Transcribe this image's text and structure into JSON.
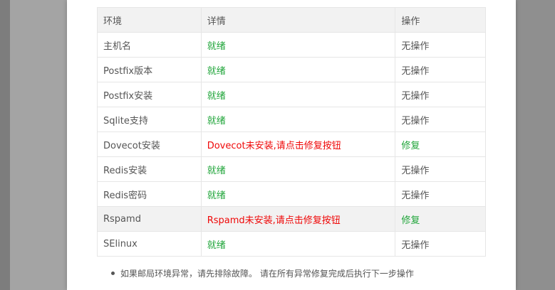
{
  "table": {
    "headers": [
      "环境",
      "详情",
      "操作"
    ],
    "rows": [
      {
        "name": "主机名",
        "detail": "就绪",
        "detail_status": "ok",
        "action": "无操作",
        "action_type": "none"
      },
      {
        "name": "Postfix版本",
        "detail": "就绪",
        "detail_status": "ok",
        "action": "无操作",
        "action_type": "none"
      },
      {
        "name": "Postfix安装",
        "detail": "就绪",
        "detail_status": "ok",
        "action": "无操作",
        "action_type": "none"
      },
      {
        "name": "Sqlite支持",
        "detail": "就绪",
        "detail_status": "ok",
        "action": "无操作",
        "action_type": "none"
      },
      {
        "name": "Dovecot安装",
        "detail": "Dovecot未安装,请点击修复按钮",
        "detail_status": "error",
        "action": "修复",
        "action_type": "fix"
      },
      {
        "name": "Redis安装",
        "detail": "就绪",
        "detail_status": "ok",
        "action": "无操作",
        "action_type": "none"
      },
      {
        "name": "Redis密码",
        "detail": "就绪",
        "detail_status": "ok",
        "action": "无操作",
        "action_type": "none"
      },
      {
        "name": "Rspamd",
        "detail": "Rspamd未安装,请点击修复按钮",
        "detail_status": "error",
        "action": "修复",
        "action_type": "fix"
      },
      {
        "name": "SElinux",
        "detail": "就绪",
        "detail_status": "ok",
        "action": "无操作",
        "action_type": "none"
      }
    ]
  },
  "tips": {
    "text": "如果邮局环境异常，请先排除故障。 请在所有异常修复完成后执行下一步操作"
  },
  "colors": {
    "ok": "#20a53a",
    "error": "#ef0808",
    "header_bg": "#f2f2f2"
  }
}
